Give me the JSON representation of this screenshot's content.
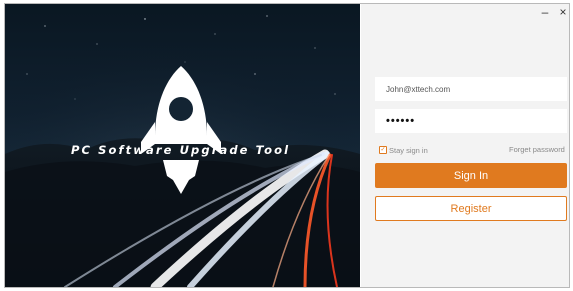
{
  "hero": {
    "title": "PC Software Upgrade Tool",
    "logo_icon": "rocket-icon"
  },
  "window_controls": {
    "minimize": "–",
    "close": "×"
  },
  "login": {
    "email_value": "John@xttech.com",
    "password_value": "••••••",
    "stay_signed_in_label": "Stay sign in",
    "stay_signed_in_checked": true,
    "forgot_password_label": "Forget password",
    "sign_in_label": "Sign In",
    "register_label": "Register"
  },
  "colors": {
    "accent": "#e07a1f",
    "panel_bg": "#f3f3f3",
    "hero_bg": "#0c1823"
  }
}
